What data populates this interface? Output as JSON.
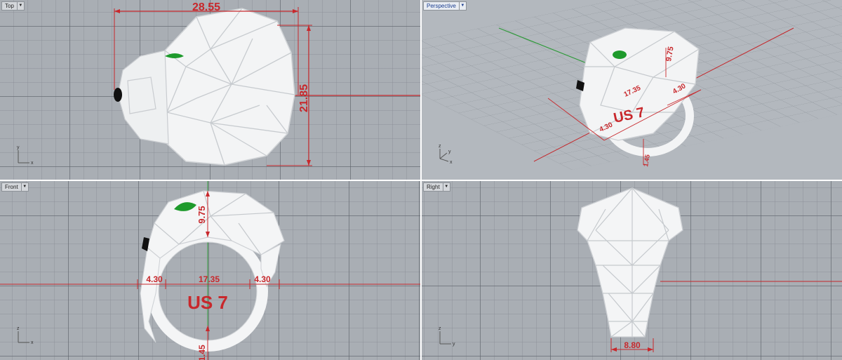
{
  "viewports": {
    "top": {
      "label": "Top",
      "dims": {
        "width": "28.55",
        "height": "21.85"
      },
      "axes": {
        "y": "y",
        "x": "x"
      }
    },
    "perspective": {
      "label": "Perspective",
      "dims": {
        "a": "9.75",
        "b": "4.30",
        "c": "17.35",
        "d": "4.30",
        "e": "1.45"
      },
      "size": "US 7",
      "axes": {
        "z": "z",
        "y": "y",
        "x": "x"
      }
    },
    "front": {
      "label": "Front",
      "dims": {
        "top": "9.75",
        "left": "4.30",
        "center": "17.35",
        "right": "4.30",
        "bottom": "1.45"
      },
      "size": "US 7",
      "axes": {
        "z": "z",
        "x": "x"
      }
    },
    "right": {
      "label": "Right",
      "dims": {
        "width": "8.80"
      },
      "axes": {
        "z": "z",
        "y": "y"
      }
    }
  },
  "colors": {
    "viewport_bg": "#a9aeb4",
    "dimension": "#c8282c",
    "gem": "#1e9a2c",
    "model": "#ffffff",
    "x_axis": "#c4282c",
    "y_axis": "#2f9a3a"
  }
}
